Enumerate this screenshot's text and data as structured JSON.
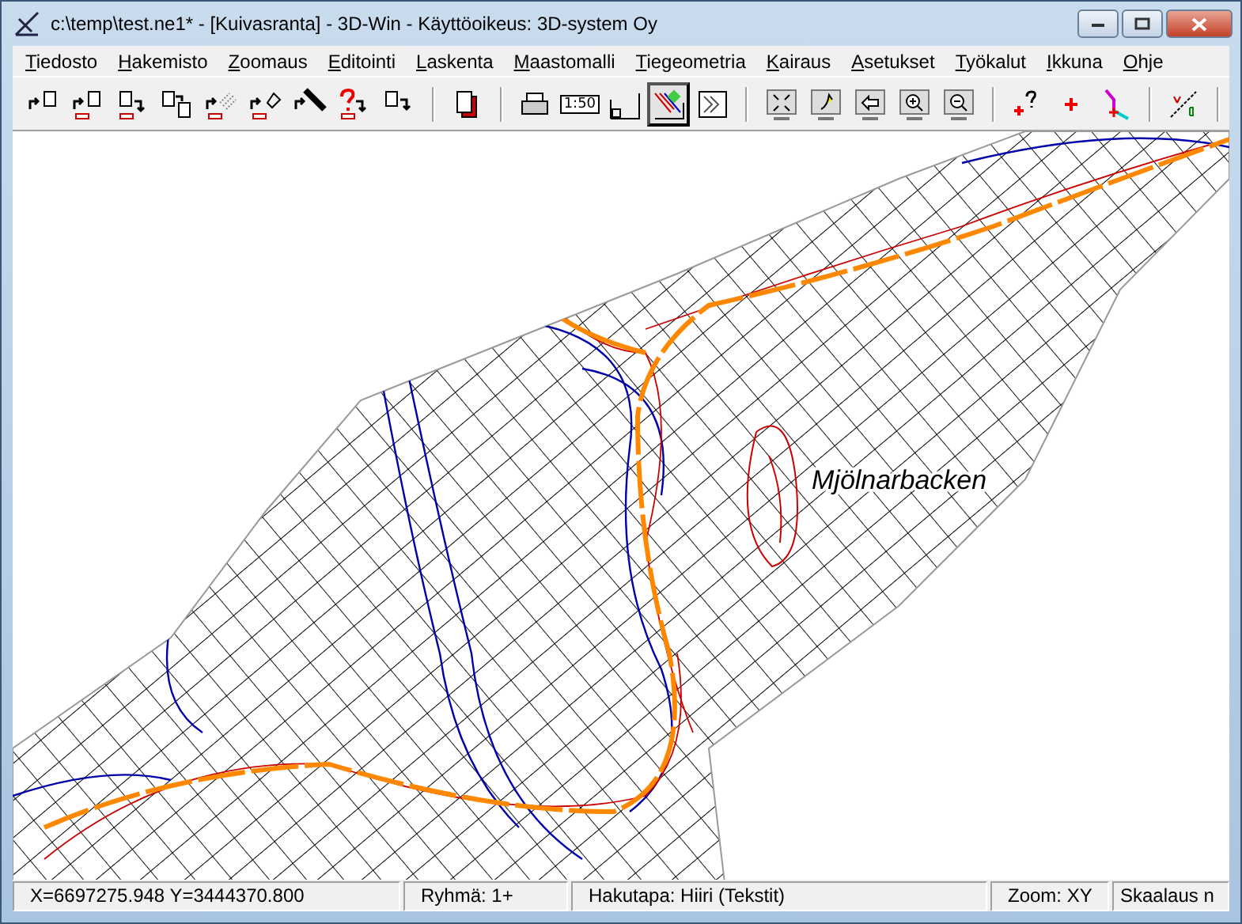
{
  "window": {
    "title": "c:\\temp\\test.ne1* - [Kuivasranta] - 3D-Win - Käyttöoikeus: 3D-system Oy"
  },
  "menu": [
    "Tiedosto",
    "Hakemisto",
    "Zoomaus",
    "Editointi",
    "Laskenta",
    "Maastomalli",
    "Tiegeometria",
    "Kairaus",
    "Asetukset",
    "Työkalut",
    "Ikkuna",
    "Ohje"
  ],
  "toolbar": [
    {
      "kind": "doc-arrow",
      "selected": false
    },
    {
      "kind": "doc-arrow-bar",
      "selected": false
    },
    {
      "kind": "doc-down",
      "selected": false
    },
    {
      "kind": "doc-double",
      "selected": false
    },
    {
      "kind": "hatch",
      "selected": false
    },
    {
      "kind": "shape",
      "selected": false
    },
    {
      "kind": "black-line",
      "selected": false
    },
    {
      "kind": "question",
      "selected": false
    },
    {
      "kind": "doc-right",
      "selected": false
    },
    {
      "kind": "sep"
    },
    {
      "kind": "copy",
      "selected": false
    },
    {
      "kind": "sep"
    },
    {
      "kind": "printer",
      "selected": false
    },
    {
      "kind": "scale",
      "label": "1:50",
      "selected": false
    },
    {
      "kind": "frame",
      "selected": false
    },
    {
      "kind": "map-layers",
      "selected": true
    },
    {
      "kind": "hatch-doc",
      "selected": false
    },
    {
      "kind": "sep"
    },
    {
      "kind": "zoom-all",
      "selected": false
    },
    {
      "kind": "zoom-pan",
      "selected": false
    },
    {
      "kind": "zoom-back",
      "selected": false
    },
    {
      "kind": "zoom-in",
      "selected": false
    },
    {
      "kind": "zoom-out",
      "selected": false
    },
    {
      "kind": "sep"
    },
    {
      "kind": "point-query",
      "selected": false
    },
    {
      "kind": "point",
      "selected": false
    },
    {
      "kind": "polyline",
      "selected": false
    },
    {
      "kind": "sep"
    },
    {
      "kind": "ab-line",
      "selected": false
    },
    {
      "kind": "sep"
    }
  ],
  "map": {
    "place_label": "Mjölnarbacken"
  },
  "status_bar": [
    "X=6697275.948  Y=3444370.800",
    "Ryhmä: 1+",
    "Hakutapa: Hiiri (Tekstit)",
    "Zoom: XY",
    "Skaalaus n"
  ]
}
